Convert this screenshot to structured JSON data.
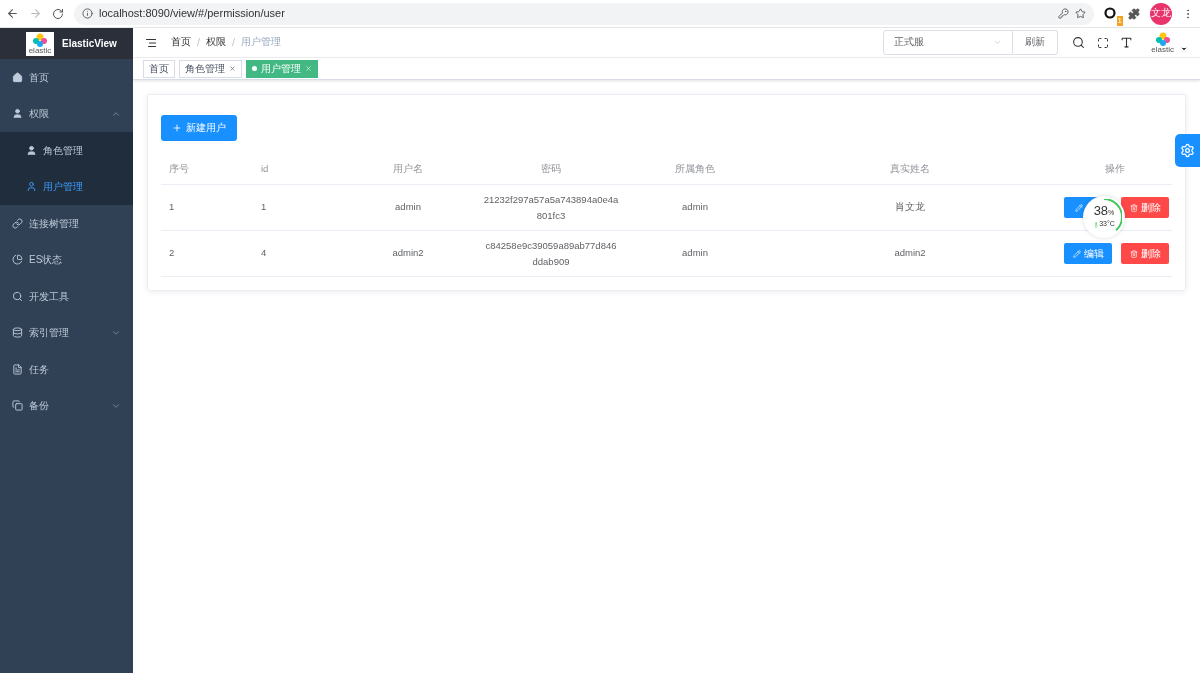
{
  "browser": {
    "url": "localhost:8090/view/#/permission/user",
    "avatar": "文龙",
    "extension_badge": "1"
  },
  "sidebar": {
    "app_name": "ElasticView",
    "logo_text": "elastic",
    "items": [
      {
        "label": "首页",
        "selected": false
      },
      {
        "label": "权限",
        "selected": false,
        "expanded": true,
        "children": [
          {
            "label": "角色管理",
            "selected": false
          },
          {
            "label": "用户管理",
            "selected": true
          }
        ]
      },
      {
        "label": "连接树管理",
        "selected": false
      },
      {
        "label": "ES状态",
        "selected": false
      },
      {
        "label": "开发工具",
        "selected": false
      },
      {
        "label": "索引管理",
        "selected": false,
        "expanded": false
      },
      {
        "label": "任务",
        "selected": false
      },
      {
        "label": "备份",
        "selected": false,
        "expanded": false
      }
    ]
  },
  "header": {
    "breadcrumb": [
      {
        "label": "首页",
        "current": false
      },
      {
        "label": "权限",
        "current": false
      },
      {
        "label": "用户管理",
        "current": true
      }
    ],
    "separators": [
      "/",
      "/"
    ],
    "env_select": {
      "value": "正式服"
    },
    "refresh_button": "刷新",
    "logo_text": "elastic"
  },
  "tags": [
    {
      "label": "首页",
      "selected": false,
      "closable": false
    },
    {
      "label": "角色管理",
      "selected": false,
      "closable": true
    },
    {
      "label": "用户管理",
      "selected": true,
      "closable": true
    }
  ],
  "new_button": "新建用户",
  "table": {
    "columns": [
      "序号",
      "id",
      "用户名",
      "密码",
      "所属角色",
      "真实姓名",
      "操作"
    ],
    "rows": [
      {
        "cells": [
          "1",
          "1",
          "admin",
          "21232f297a57a5a743894a0e4a801fc3",
          "admin",
          "肖文龙"
        ],
        "delete": "删除"
      },
      {
        "cells": [
          "2",
          "4",
          "admin2",
          "c84258e9c39059a89ab77d846ddab909",
          "admin",
          "admin2"
        ],
        "edit": "编辑",
        "delete": "删除"
      }
    ]
  },
  "monitor": {
    "reading": "38",
    "unit": "%",
    "temperature": "33°C",
    "level": 0.38
  }
}
